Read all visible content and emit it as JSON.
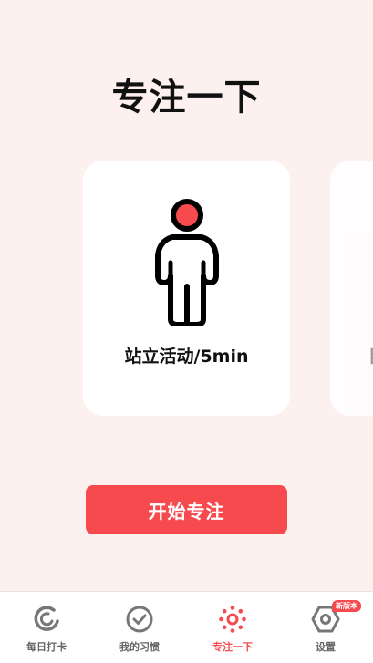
{
  "page_title": "专注一下",
  "cards": [
    {
      "label": "站立活动/5min",
      "icon": "standing-person-icon"
    },
    {
      "label": "目",
      "icon": "next-activity-icon"
    }
  ],
  "start_button_label": "开始专注",
  "tabbar": {
    "items": [
      {
        "label": "每日打卡",
        "icon": "daily-checkin-icon",
        "active": false
      },
      {
        "label": "我的习惯",
        "icon": "check-circle-icon",
        "active": false
      },
      {
        "label": "专注一下",
        "icon": "focus-dots-icon",
        "active": true
      },
      {
        "label": "设置",
        "icon": "gear-icon",
        "active": false
      }
    ],
    "settings_badge": "新版本"
  },
  "colors": {
    "accent": "#f64a4f",
    "background": "#fdf1ef",
    "inactive": "#666666"
  }
}
